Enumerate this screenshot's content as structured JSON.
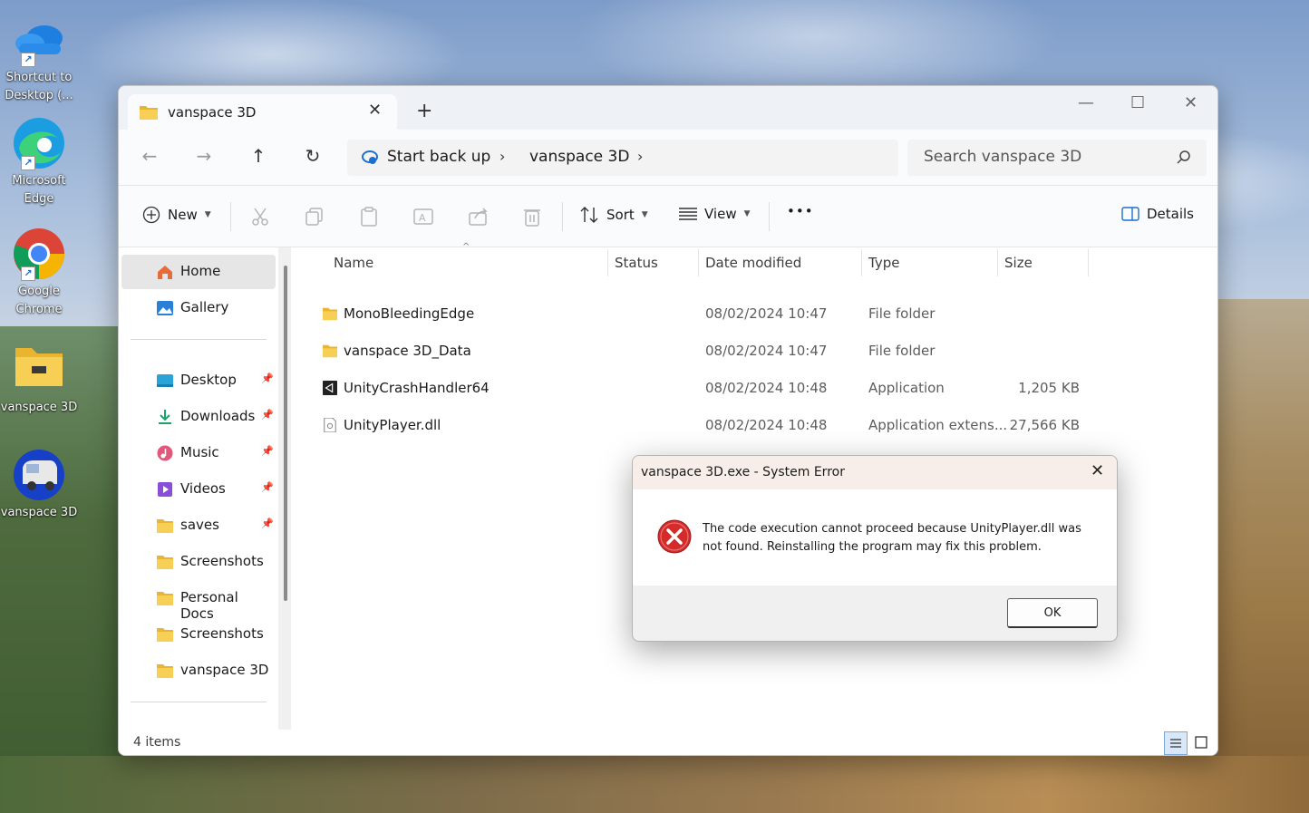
{
  "desktop": {
    "icons": [
      {
        "label_line1": "Shortcut to",
        "label_line2": "Desktop (...",
        "icon": "onedrive-cloud-icon"
      },
      {
        "label_line1": "Microsoft",
        "label_line2": "Edge",
        "icon": "edge-icon"
      },
      {
        "label_line1": "Google",
        "label_line2": "Chrome",
        "icon": "chrome-icon"
      },
      {
        "label_line1": "vanspace 3D",
        "label_line2": "",
        "icon": "folder-icon"
      },
      {
        "label_line1": "vanspace 3D",
        "label_line2": "",
        "icon": "van-app-icon"
      }
    ]
  },
  "window": {
    "tab_title": "vanspace 3D",
    "new_tab_symbol": "+",
    "close_tab_symbol": "✕",
    "controls": {
      "minimize": "—",
      "maximize": "☐",
      "close": "✕"
    }
  },
  "nav": {
    "breadcrumb": [
      "Start back up",
      "vanspace 3D"
    ],
    "search_placeholder": "Search vanspace 3D"
  },
  "toolbar": {
    "new_label": "New",
    "sort_label": "Sort",
    "view_label": "View",
    "more_label": "•••",
    "details_label": "Details"
  },
  "sidebar": {
    "home": "Home",
    "gallery": "Gallery",
    "pinned": [
      "Desktop",
      "Downloads",
      "Music",
      "Videos",
      "saves"
    ],
    "folders": [
      "Screenshots",
      "Personal Docs",
      "Screenshots",
      "vanspace 3D"
    ]
  },
  "columns": {
    "name": "Name",
    "status": "Status",
    "date": "Date modified",
    "type": "Type",
    "size": "Size"
  },
  "files": [
    {
      "name": "MonoBleedingEdge",
      "date": "08/02/2024 10:47",
      "type": "File folder",
      "size": "",
      "icon": "folder-icon"
    },
    {
      "name": "vanspace 3D_Data",
      "date": "08/02/2024 10:47",
      "type": "File folder",
      "size": "",
      "icon": "folder-icon"
    },
    {
      "name": "UnityCrashHandler64",
      "date": "08/02/2024 10:48",
      "type": "Application",
      "size": "1,205 KB",
      "icon": "unity-app-icon"
    },
    {
      "name": "UnityPlayer.dll",
      "date": "08/02/2024 10:48",
      "type": "Application extens...",
      "size": "27,566 KB",
      "icon": "dll-file-icon"
    }
  ],
  "status": {
    "item_count": "4 items"
  },
  "dialog": {
    "title": "vanspace 3D.exe - System Error",
    "message": "The code execution cannot proceed because UnityPlayer.dll was not found. Reinstalling the program may fix this problem.",
    "ok_label": "OK",
    "close_symbol": "✕"
  },
  "colors": {
    "folder": "#f7c948",
    "selection": "#e6e6e6",
    "error_red": "#d42b2b",
    "accent_blue": "#1a6fd1"
  }
}
